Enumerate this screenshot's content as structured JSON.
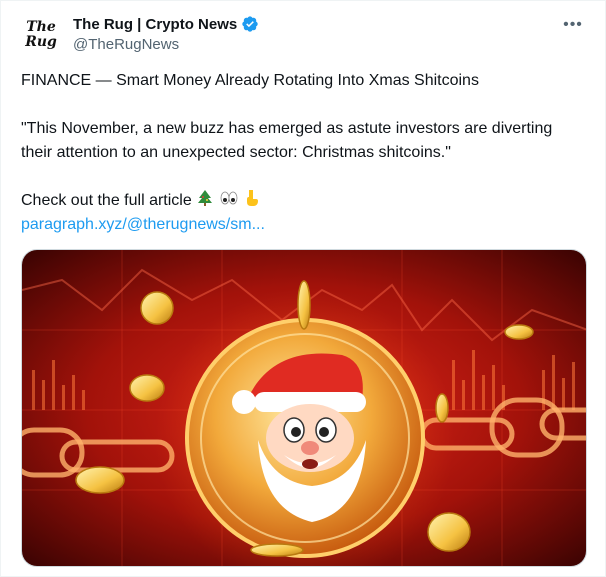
{
  "author": {
    "avatar_line1": "The",
    "avatar_line2": "Rug",
    "name": "The Rug | Crypto News",
    "handle": "@TheRugNews"
  },
  "tweet": {
    "headline": "FINANCE — Smart Money Already Rotating Into Xmas Shitcoins",
    "quote": "\"This November, a new buzz has emerged as astute investors are diverting their attention to an unexpected sector: Christmas shitcoins.\"",
    "cta": "Check out the full article",
    "link": "paragraph.xyz/@therugnews/sm..."
  },
  "icons": {
    "verified": "verified-badge-icon",
    "more": "more-options-icon",
    "emojis": [
      "christmas-tree-emoji",
      "eyes-emoji",
      "pointing-down-emoji"
    ]
  },
  "colors": {
    "link": "#1d9bf0",
    "verified": "#1d9bf0",
    "media_bg": "#7a0a05"
  }
}
